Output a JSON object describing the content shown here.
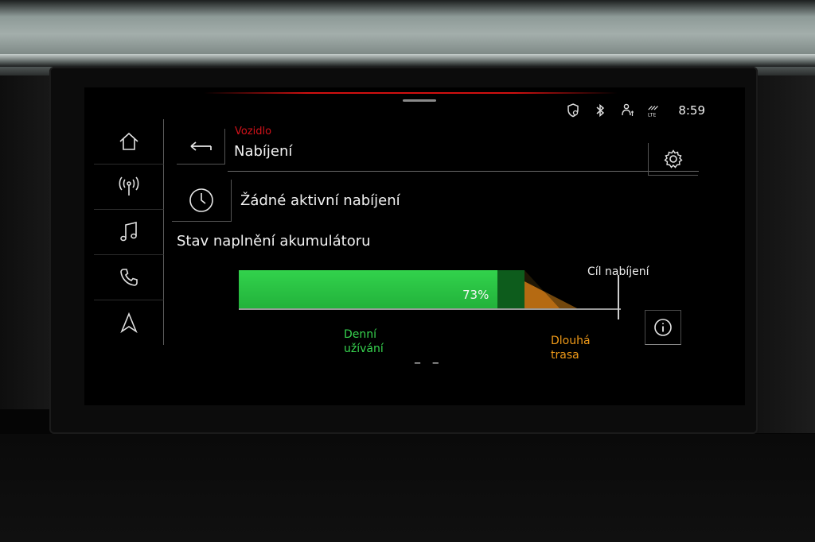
{
  "status_bar": {
    "time": "8:59",
    "icons": [
      "privacy-shield-icon",
      "bluetooth-icon",
      "assistance-icon",
      "lte-data-icon"
    ],
    "lte_label": "LTE"
  },
  "nav": {
    "items": [
      {
        "icon": "home-icon"
      },
      {
        "icon": "radio-icon"
      },
      {
        "icon": "music-note-icon"
      },
      {
        "icon": "phone-icon"
      },
      {
        "icon": "navigation-arrow-icon"
      }
    ]
  },
  "header": {
    "breadcrumb": "Vozidlo",
    "title": "Nabíjení"
  },
  "timer": {
    "status_text": "Žádné aktivní nabíjení"
  },
  "battery": {
    "section_title": "Stav naplnění akumulátoru",
    "level_percent": 73,
    "level_label": "73%",
    "target_label": "Cíl nabíjení",
    "daily_label_line1": "Denní",
    "daily_label_line2": "užívání",
    "range_value": "– –",
    "long_trip_line1": "Dlouhá",
    "long_trip_line2": "trasa"
  },
  "colors": {
    "accent_red": "#d4121a",
    "battery_green": "#2fcf4a",
    "long_trip_orange": "#f09a18"
  }
}
